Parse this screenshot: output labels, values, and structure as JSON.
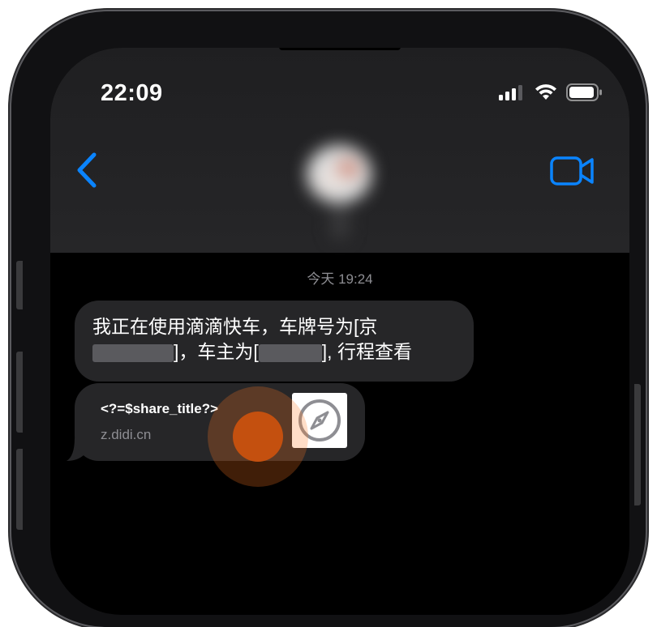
{
  "status_bar": {
    "time": "22:09"
  },
  "header": {
    "back_icon": "chevron-left-icon",
    "video_icon": "video-camera-icon",
    "accent_color": "#0a84ff"
  },
  "conversation": {
    "timestamp": "今天 19:24",
    "message": {
      "line1": "我正在使用滴滴快车，车牌号为[京",
      "line2_a": "]，车主为[",
      "line2_b": "], 行程查看"
    },
    "link_preview": {
      "title": "<?=$share_title?>",
      "domain": "z.didi.cn",
      "thumb_icon": "safari-compass-icon"
    }
  }
}
